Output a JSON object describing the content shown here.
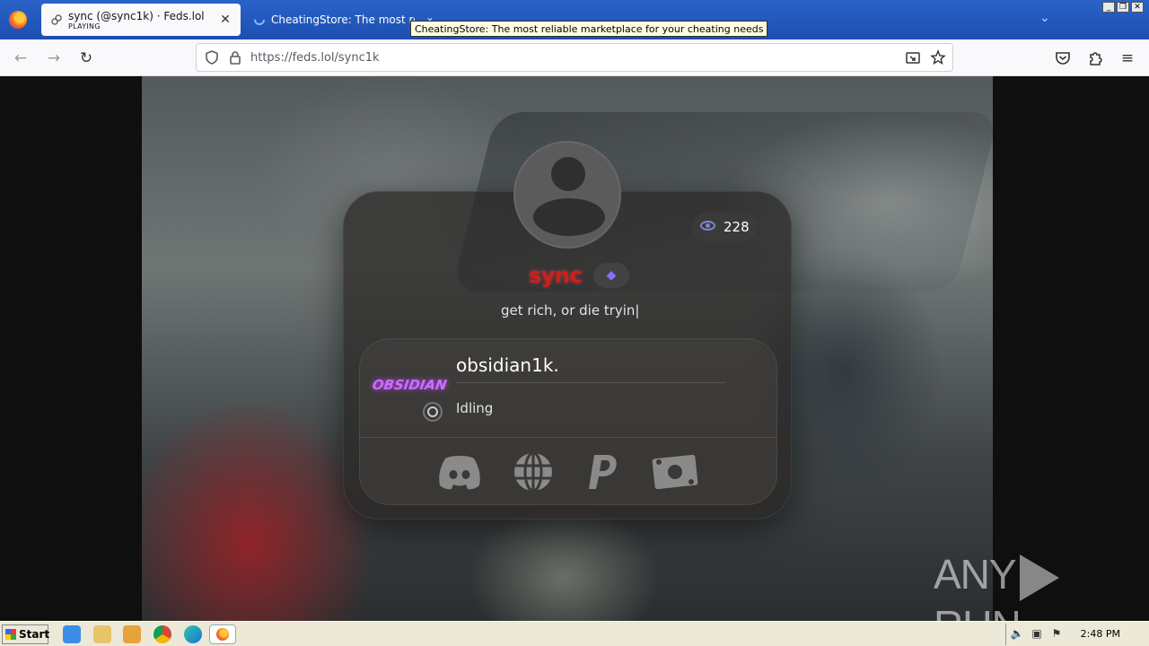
{
  "browser": {
    "tabs": [
      {
        "title": "sync (@sync1k) · Feds.lol",
        "subtitle": "PLAYING",
        "active": true
      },
      {
        "title": "CheatingStore: The most reliable",
        "active": false
      }
    ],
    "tooltip": "CheatingStore: The most reliable marketplace for your cheating needs",
    "url": "https://feds.lol/sync1k"
  },
  "profile": {
    "views": "228",
    "name": "sync",
    "bio": "get rich, or die tryin|",
    "discord": {
      "username": "obsidian1k.",
      "avatar_text": "OBSIDIAN",
      "activity": "Idling"
    },
    "socials": [
      "discord-icon",
      "globe-icon",
      "paypal-icon",
      "cash-icon"
    ]
  },
  "watermark": {
    "left": "ANY",
    "right": "RUN"
  },
  "taskbar": {
    "start_label": "Start",
    "clock": "2:48 PM"
  },
  "colors": {
    "name": "#d41c1c",
    "accent": "#7a86d6",
    "gem": "#8a6bff"
  }
}
